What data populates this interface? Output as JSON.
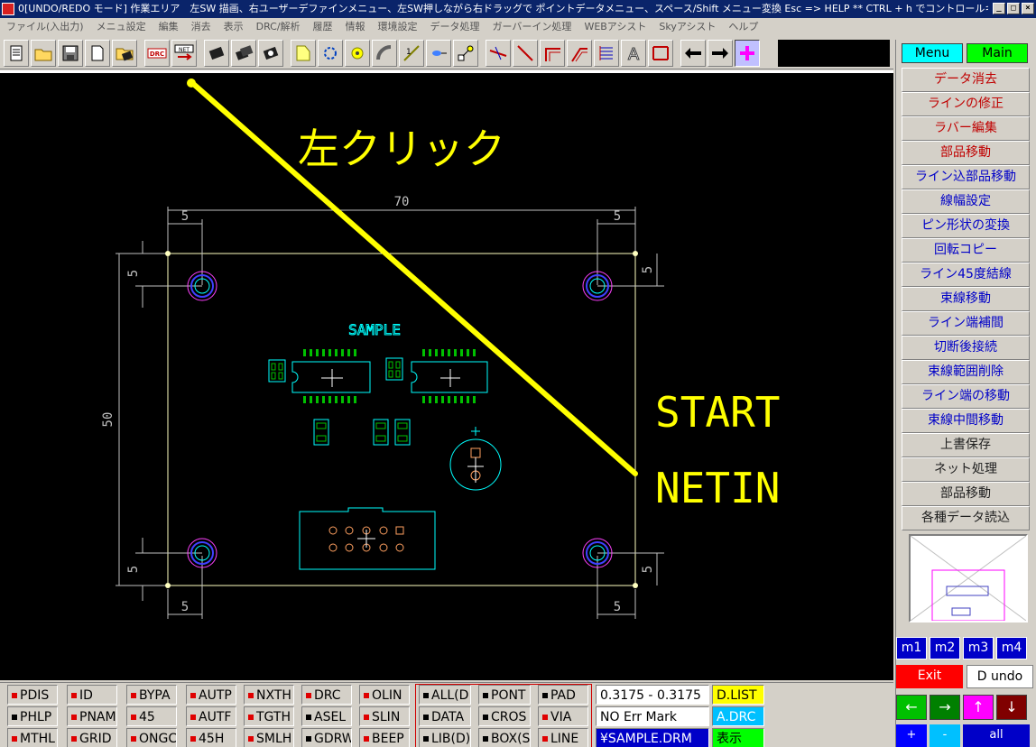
{
  "titlebar": {
    "title": "0[UNDO/REDO モード] 作業エリア　左SW 描画、右ユーザーデファインメニュー、左SW押しながら右ドラッグで ポイントデータメニュー、スペース/Shift メニュー変換  Esc => HELP  ** CTRL + h でコントロールキーコマンド",
    "minimize": "_",
    "maximize": "□",
    "close": "×"
  },
  "menubar": [
    "ファイル(入出力)",
    "メニュ設定",
    "編集",
    "消去",
    "表示",
    "DRC/解析",
    "履歴",
    "情報",
    "環境設定",
    "データ処理",
    "ガーバーイン処理",
    "WEBアシスト",
    "Skyアシスト",
    "ヘルプ"
  ],
  "toolbar": {
    "drc_label": "DRC",
    "net_label": "NET"
  },
  "canvas": {
    "annotation_click": "左クリック",
    "annotation_start": "START",
    "annotation_netin": "NETIN",
    "board_label": "SAMPLE",
    "dim_width": "70",
    "dim_height": "50",
    "dim_5_top_left": "5",
    "dim_5_top_right": "5",
    "dim_5_bottom_left": "5",
    "dim_5_bottom_right": "5",
    "dim_5_left_top": "5",
    "dim_5_left_bottom": "5",
    "dim_5_right_top": "5",
    "dim_5_right_bottom": "5"
  },
  "rightpanel": {
    "tab_menu": "Menu",
    "tab_main": "Main",
    "commands": [
      {
        "label": "データ消去",
        "color": "red"
      },
      {
        "label": "ラインの修正",
        "color": "red"
      },
      {
        "label": "ラバー編集",
        "color": "red"
      },
      {
        "label": "部品移動",
        "color": "red"
      },
      {
        "label": "ライン込部品移動",
        "color": "blue"
      },
      {
        "label": "線幅設定",
        "color": "blue"
      },
      {
        "label": "ピン形状の変換",
        "color": "blue"
      },
      {
        "label": "回転コピー",
        "color": "blue"
      },
      {
        "label": "ライン45度結線",
        "color": "blue"
      },
      {
        "label": "束線移動",
        "color": "blue"
      },
      {
        "label": "ライン端補間",
        "color": "blue"
      },
      {
        "label": "切断後接続",
        "color": "blue"
      },
      {
        "label": "束線範囲削除",
        "color": "blue"
      },
      {
        "label": "ライン端の移動",
        "color": "blue"
      },
      {
        "label": "束線中間移動",
        "color": "blue"
      },
      {
        "label": "上書保存",
        "color": "black"
      },
      {
        "label": "ネット処理",
        "color": "black"
      },
      {
        "label": "部品移動",
        "color": "black"
      },
      {
        "label": "各種データ読込",
        "color": "black"
      }
    ],
    "m_buttons": [
      "m1",
      "m2",
      "m3",
      "m4"
    ],
    "exit_label": "Exit",
    "dundo_label": "D undo",
    "arrows": [
      "←",
      "→",
      "↑",
      "↓"
    ],
    "bottom": [
      "+",
      "-",
      "all"
    ],
    "colors": {
      "m_blue": "#0000c8",
      "left_green": "#00c000",
      "right_green": "#008000",
      "up_magenta": "#ff00ff",
      "down_darkred": "#800000",
      "plus_blue": "#0000ff",
      "minus_cyan": "#00c0ff",
      "all_blue": "#0000c8"
    }
  },
  "status": {
    "col1": [
      {
        "label": "PDIS",
        "mark": "red"
      },
      {
        "label": "PHLP",
        "mark": "black"
      },
      {
        "label": "MTHL",
        "mark": "red"
      }
    ],
    "col2": [
      {
        "label": "ID",
        "mark": "red"
      },
      {
        "label": "PNAM",
        "mark": "red"
      },
      {
        "label": "GRID",
        "mark": "red"
      }
    ],
    "col3": [
      {
        "label": "BYPA",
        "mark": "red"
      },
      {
        "label": "45",
        "mark": "red"
      },
      {
        "label": "ONGC",
        "mark": "red"
      }
    ],
    "col4": [
      {
        "label": "AUTP",
        "mark": "red"
      },
      {
        "label": "AUTF",
        "mark": "red"
      },
      {
        "label": "45H",
        "mark": "red"
      }
    ],
    "col5": [
      {
        "label": "NXTH",
        "mark": "red"
      },
      {
        "label": "TGTH",
        "mark": "red"
      },
      {
        "label": "SMLH",
        "mark": "red"
      }
    ],
    "col6": [
      {
        "label": "DRC",
        "mark": "red"
      },
      {
        "label": "ASEL",
        "mark": "black"
      },
      {
        "label": "GDRW",
        "mark": "black"
      }
    ],
    "col7": [
      {
        "label": "OLIN",
        "mark": "red"
      },
      {
        "label": "SLIN",
        "mark": "red"
      },
      {
        "label": "BEEP",
        "mark": "red"
      }
    ],
    "col8": [
      {
        "label": "ALL(D",
        "mark": "black"
      },
      {
        "label": "DATA",
        "mark": "black"
      },
      {
        "label": "LIB(D)",
        "mark": "black"
      }
    ],
    "col9": [
      {
        "label": "PONT",
        "mark": "black"
      },
      {
        "label": "CROS",
        "mark": "black"
      },
      {
        "label": "BOX(S",
        "mark": "black"
      }
    ],
    "col10": [
      {
        "label": "PAD",
        "mark": "black"
      },
      {
        "label": "VIA",
        "mark": "red"
      },
      {
        "label": "LINE",
        "mark": "red"
      }
    ],
    "coords": "0.3175 - 0.3175",
    "err": "NO Err Mark",
    "file": "¥SAMPLE.DRM",
    "dlist": "D.LIST",
    "adrc": "A.DRC",
    "hyoji": "表示"
  }
}
